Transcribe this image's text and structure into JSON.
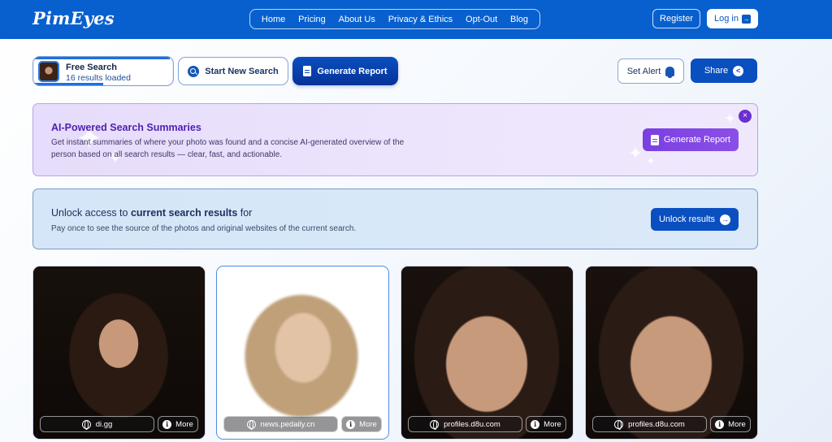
{
  "header": {
    "logo": "PimEyes",
    "nav": [
      "Home",
      "Pricing",
      "About Us",
      "Privacy & Ethics",
      "Opt-Out",
      "Blog"
    ],
    "register_label": "Register",
    "login_label": "Log in"
  },
  "toolbar": {
    "free_search_title": "Free Search",
    "free_search_sub": "16 results loaded",
    "start_label": "Start New Search",
    "generate_label": "Generate Report",
    "alert_label": "Set Alert",
    "share_label": "Share"
  },
  "ai_banner": {
    "title": "AI-Powered Search Summaries",
    "description": "Get instant summaries of where your photo was found and a concise AI-generated overview of the person based on all search results — clear, fast, and actionable.",
    "button_label": "Generate Report",
    "close": "×"
  },
  "unlock_banner": {
    "title_prefix": "Unlock access to ",
    "title_bold": "current search results",
    "title_suffix": " for",
    "description": "Pay once to see the source of the photos and original websites of the current search.",
    "button_label": "Unlock results"
  },
  "results": [
    {
      "source": "di.gg",
      "more": "More"
    },
    {
      "source": "news.pedaily.cn",
      "more": "More"
    },
    {
      "source": "profiles.d8u.com",
      "more": "More"
    },
    {
      "source": "profiles.d8u.com",
      "more": "More"
    }
  ],
  "colors": {
    "header_bg": "#0860cf",
    "accent_blue": "#0a4fc0",
    "ai_purple": "#7a3fe0"
  }
}
